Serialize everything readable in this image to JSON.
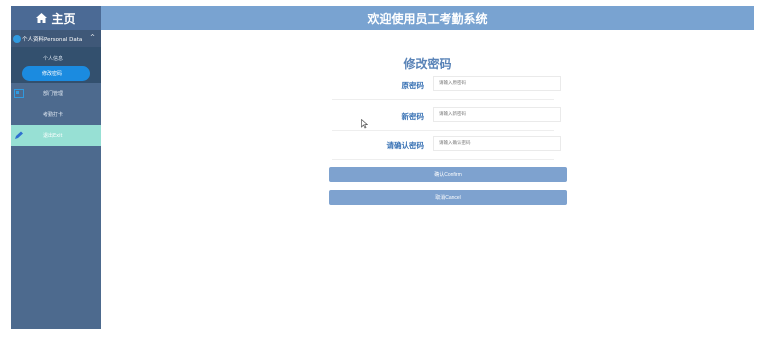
{
  "header": {
    "home_label": "主页",
    "title": "欢迎使用员工考勤系统"
  },
  "sidebar": {
    "group_label": "个人资料Personal Data",
    "group_chevron": "^",
    "sub_items": [
      "个人信息",
      "修改密码"
    ],
    "items": [
      {
        "label": "部门管理",
        "icon": "id-card-icon"
      },
      {
        "label": "考勤打卡",
        "icon": ""
      },
      {
        "label": "退出Exit",
        "icon": "pencil-icon"
      }
    ]
  },
  "form": {
    "title": "修改密码",
    "old_password": {
      "label": "原密码",
      "placeholder": "请输入原密码"
    },
    "new_password": {
      "label": "新密码",
      "placeholder": "请输入新密码"
    },
    "confirm_password": {
      "label": "请确认密码",
      "placeholder": "请输入确认密码"
    },
    "confirm_button": "确认Confirm",
    "cancel_button": "取消Cancel"
  },
  "colors": {
    "sidebar": "#4d6a8e",
    "topbar": "#79a3d1",
    "active": "#1b8be0",
    "exit": "#97e0d4",
    "button": "#7ea2cf"
  }
}
